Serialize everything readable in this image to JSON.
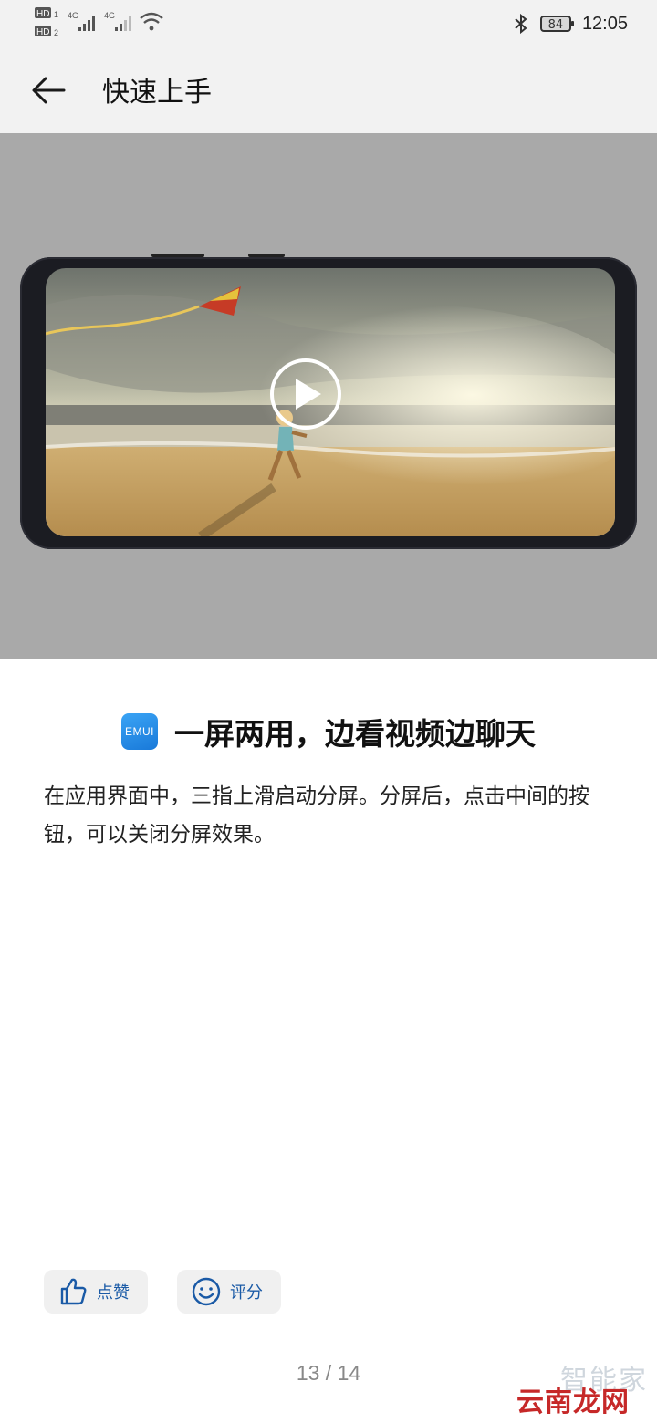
{
  "status_bar": {
    "sim1_badge": "HD",
    "sim1_index": "1",
    "sim2_badge": "HD",
    "sim2_index": "2",
    "network1": "4G",
    "network2": "4G",
    "battery_level": "84",
    "time": "12:05",
    "icons": [
      "bluetooth-icon",
      "wifi-icon",
      "signal-icon",
      "battery-icon"
    ]
  },
  "app_bar": {
    "title": "快速上手",
    "back_icon": "arrow-left-icon"
  },
  "media": {
    "play_icon": "play-icon",
    "background_color": "#a9a9a9"
  },
  "content": {
    "logo_text": "EMUI",
    "heading": "一屏两用，边看视频边聊天",
    "description": "在应用界面中，三指上滑启动分屏。分屏后，点击中间的按钮，可以关闭分屏效果。"
  },
  "actions": {
    "like_label": "点赞",
    "like_icon": "thumbs-up-icon",
    "rate_label": "评分",
    "rate_icon": "smiley-icon",
    "accent_color": "#1a5aa6"
  },
  "pagination": {
    "indicator": "13 / 14"
  },
  "watermarks": {
    "top": "智能家",
    "bottom": "云南龙网"
  }
}
